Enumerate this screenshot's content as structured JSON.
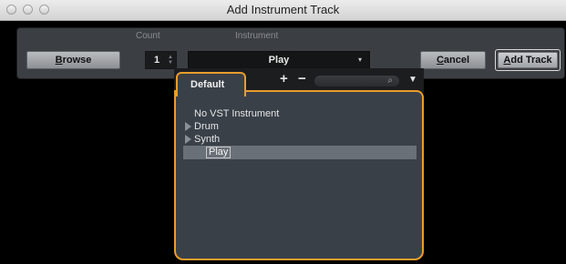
{
  "window": {
    "title": "Add Instrument Track"
  },
  "columns": {
    "count_label": "Count",
    "instrument_label": "Instrument"
  },
  "toolbar": {
    "browse_label": "Browse",
    "count_value": "1",
    "instrument_value": "Play",
    "cancel_label": "Cancel",
    "add_track_label": "Add Track"
  },
  "popup": {
    "tab_label": "Default",
    "add_symbol": "+",
    "remove_symbol": "−",
    "search_value": "",
    "items": [
      {
        "label": "No VST Instrument",
        "expandable": false
      },
      {
        "label": "Drum",
        "expandable": true
      },
      {
        "label": "Synth",
        "expandable": true
      },
      {
        "label": "Play",
        "expandable": false,
        "selected": true
      }
    ]
  },
  "colors": {
    "accent": "#e99d2c",
    "panel": "#3b3e42",
    "popup_bg": "#394048",
    "selection": "#6a7078"
  },
  "icons": [
    "search-icon",
    "chevron-down-icon",
    "expand-triangle-icon",
    "stepper-icon"
  ]
}
